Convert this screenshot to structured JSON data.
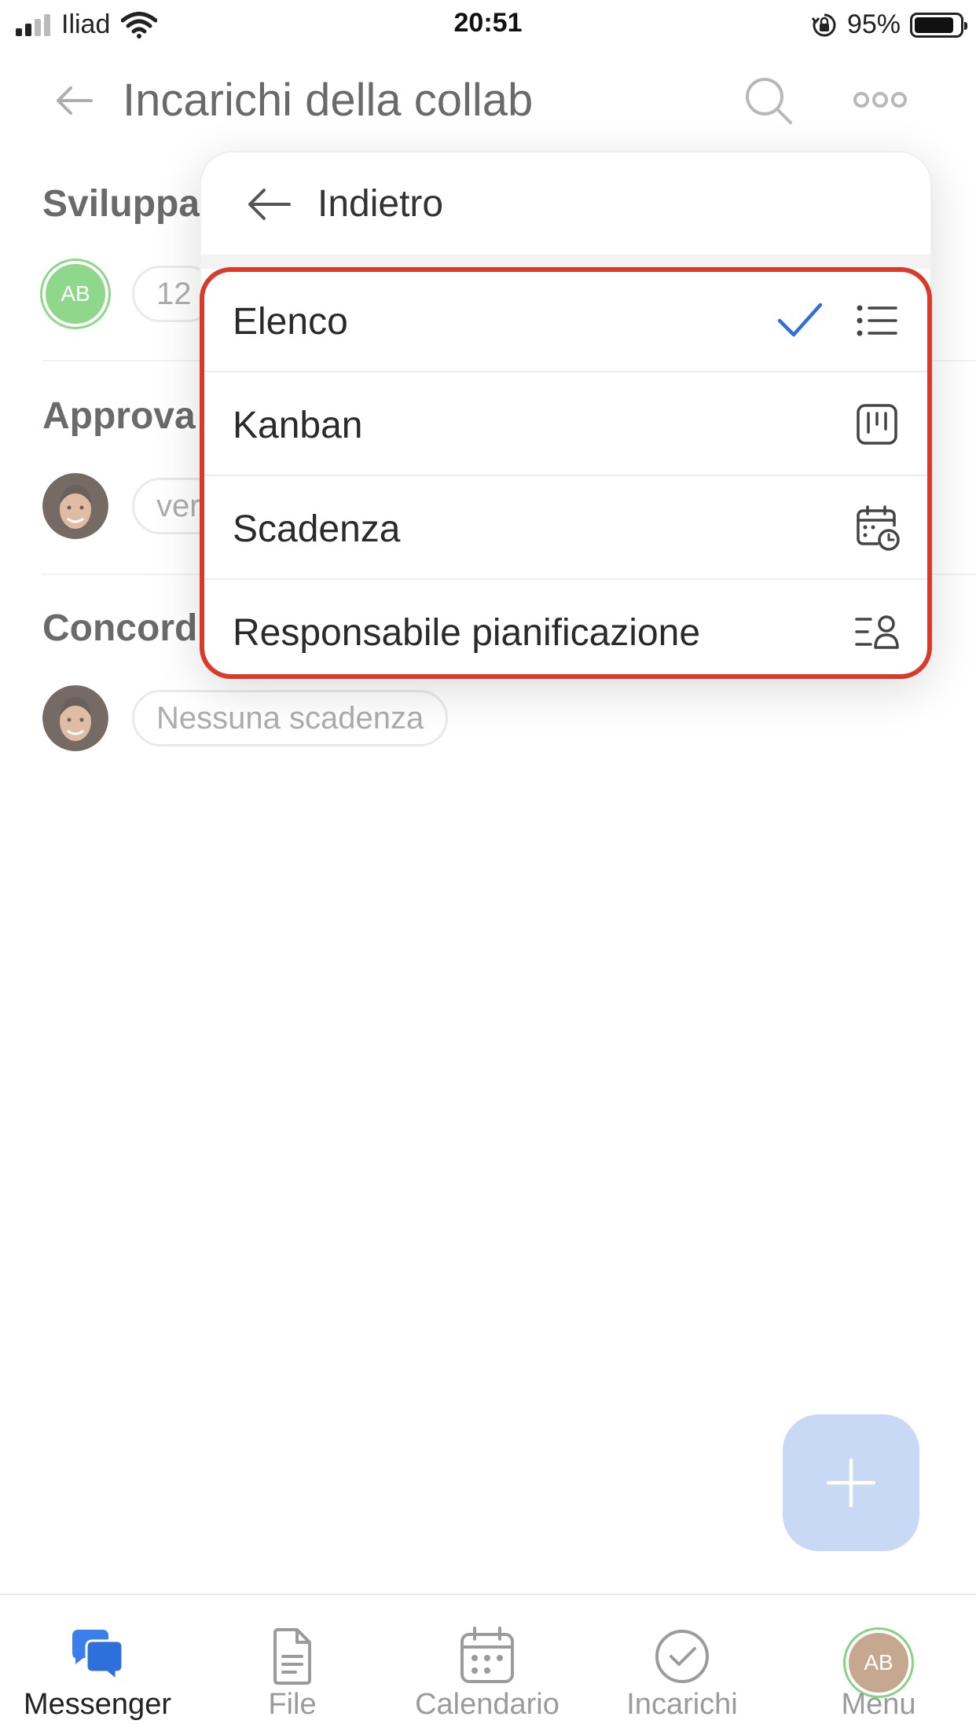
{
  "status_bar": {
    "carrier": "Iliad",
    "time": "20:51",
    "battery_percent": "95%"
  },
  "header": {
    "title": "Incarichi della collab",
    "back_icon": "arrow-left-icon",
    "search_icon": "search-icon",
    "more_icon": "more-horizontal-icon"
  },
  "tasks": [
    {
      "title": "Sviluppa",
      "avatar_initials": "AB",
      "chip": "12"
    },
    {
      "title": "Approva",
      "chip": "ver"
    },
    {
      "title": "Concord",
      "chip": "Nessuna scadenza"
    }
  ],
  "dropdown": {
    "back_label": "Indietro",
    "options": [
      {
        "label": "Elenco",
        "icon": "list-icon",
        "selected": true
      },
      {
        "label": "Kanban",
        "icon": "kanban-icon",
        "selected": false
      },
      {
        "label": "Scadenza",
        "icon": "calendar-clock-icon",
        "selected": false
      },
      {
        "label": "Responsabile pianificazione",
        "icon": "assignee-list-icon",
        "selected": false
      }
    ]
  },
  "fab": {
    "icon": "plus-icon"
  },
  "bottom_nav": {
    "items": [
      {
        "label": "Messenger",
        "icon": "chat-bubbles-icon",
        "active": true
      },
      {
        "label": "File",
        "icon": "file-icon",
        "active": false
      },
      {
        "label": "Calendario",
        "icon": "calendar-icon",
        "active": false
      },
      {
        "label": "Incarichi",
        "icon": "check-circle-icon",
        "active": false
      },
      {
        "label": "Menu",
        "avatar_initials": "AB",
        "active": false
      }
    ]
  },
  "colors": {
    "accent_blue": "#2d6fdb",
    "highlight_red": "#d93b2b",
    "avatar_green": "#5ec65a",
    "fab_bg": "#c7d9f4"
  }
}
